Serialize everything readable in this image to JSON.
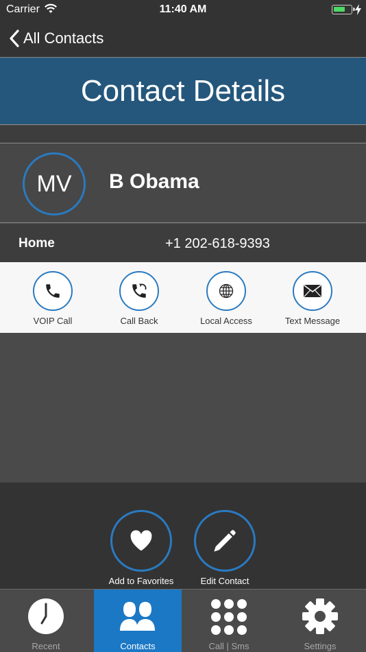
{
  "status_bar": {
    "carrier": "Carrier",
    "time": "11:40 AM"
  },
  "nav": {
    "back_label": "All Contacts"
  },
  "title": "Contact Details",
  "contact": {
    "initials": "MV",
    "name": "B Obama",
    "phone_type": "Home",
    "phone_number": "+1 202-618-9393"
  },
  "actions": [
    {
      "label": "VOIP Call",
      "icon": "phone-icon"
    },
    {
      "label": "Call Back",
      "icon": "callback-icon"
    },
    {
      "label": "Local Access",
      "icon": "globe-icon"
    },
    {
      "label": "Text Message",
      "icon": "envelope-icon"
    }
  ],
  "bottom_actions": {
    "favorites_label": "Add to Favorites",
    "edit_label": "Edit Contact"
  },
  "tabs": [
    {
      "label": "Recent",
      "icon": "clock-icon"
    },
    {
      "label": "Contacts",
      "icon": "people-icon",
      "active": true
    },
    {
      "label": "Call | Sms",
      "icon": "dialpad-icon"
    },
    {
      "label": "Settings",
      "icon": "gear-icon"
    }
  ],
  "colors": {
    "accent": "#2a7ac0",
    "banner": "#25577c",
    "active_tab": "#1b78c5"
  }
}
